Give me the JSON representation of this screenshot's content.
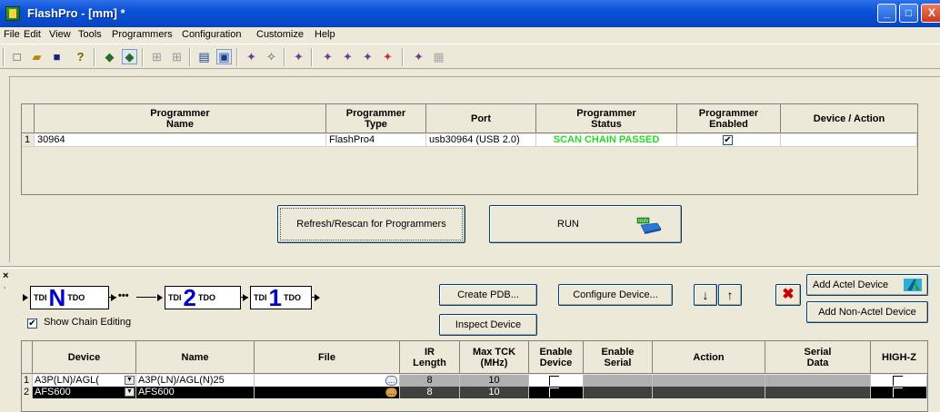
{
  "window": {
    "title": "FlashPro - [mm] *",
    "min": "_",
    "max": "□",
    "close": "X"
  },
  "menu": [
    "File",
    "Edit",
    "View",
    "Tools",
    "Programmers",
    "Configuration",
    "Customize",
    "Help"
  ],
  "toolbar_icons": [
    "new-icon",
    "open-icon",
    "save-icon",
    "help-icon",
    "programmer-icon",
    "programmer-selected-icon",
    "chain-icon",
    "chain2-icon",
    "log-icon",
    "list-icon",
    "device-prog-icon",
    "device-run-icon",
    "device-add-icon",
    "prog-a-icon",
    "prog-b-icon",
    "prog-c-icon",
    "prog-d-icon",
    "prog-e-icon",
    "disabled-icon"
  ],
  "programmer_table": {
    "headers": {
      "name": "Programmer\nName",
      "type": "Programmer\nType",
      "port": "Port",
      "status": "Programmer\nStatus",
      "enabled": "Programmer\nEnabled",
      "action": "Device / Action"
    },
    "row": {
      "index": "1",
      "name": "30964",
      "type": "FlashPro4",
      "port": "usb30964 (USB 2.0)",
      "status": "SCAN CHAIN PASSED",
      "enabled": true,
      "action": ""
    }
  },
  "buttons": {
    "refresh": "Refresh/Rescan for Programmers",
    "run": "RUN",
    "run_badge": "RUN",
    "create_pdb": "Create PDB...",
    "inspect": "Inspect Device",
    "configure": "Configure Device...",
    "add_actel": "Add Actel Device",
    "add_non_actel": "Add Non-Actel Device"
  },
  "chain": {
    "tdi": "TDI",
    "tdo": "TDO",
    "n": "N",
    "two": "2",
    "one": "1",
    "dots": "•••",
    "show_chain_editing_label": "Show Chain Editing",
    "show_chain_editing": true
  },
  "device_table": {
    "headers": {
      "device": "Device",
      "name": "Name",
      "file": "File",
      "ir": "IR\nLength",
      "tck": "Max TCK\n(MHz)",
      "enable_device": "Enable\nDevice",
      "enable_serial": "Enable\nSerial",
      "action": "Action",
      "serial": "Serial\nData",
      "highz": "HIGH-Z"
    },
    "rows": [
      {
        "index": "1",
        "device": "A3P(LN)/AGL(",
        "name": "A3P(LN)/AGL(N)25",
        "file": "",
        "ir": "8",
        "tck": "10"
      },
      {
        "index": "2",
        "device": "AFS600",
        "name": "AFS600",
        "file": "",
        "ir": "8",
        "tck": "10"
      }
    ]
  },
  "colors": {
    "status_green": "#22dd22",
    "title_blue": "#0a52d8",
    "chain_blue": "#0000cc",
    "remove_red": "#cc0000"
  }
}
